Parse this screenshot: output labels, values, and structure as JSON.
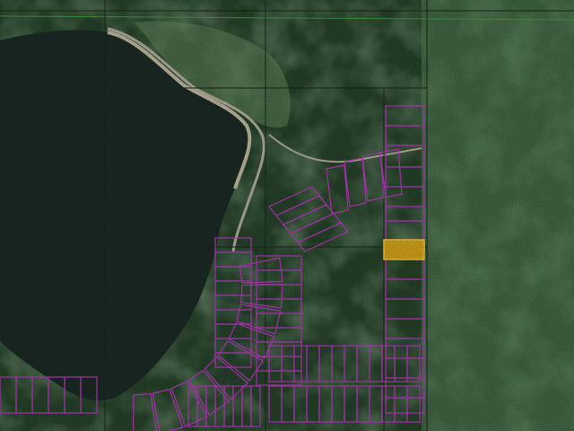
{
  "map": {
    "kind": "satellite-parcel-map",
    "colors": {
      "forest_dark": "#27452b",
      "forest_mid": "#3f6a43",
      "forest_light": "#5b8a59",
      "clearing": "#6b8f62",
      "lake": "#1c2c26",
      "shore": "#c8c1a8",
      "road": "#bdb7a3",
      "section_line": "#1f261f",
      "green_line": "#4aa04a",
      "parcel_outline": "#c23bc8",
      "selected_fill": "#f1b51a",
      "selected_outline": "#ffd23c"
    },
    "selected_parcel": {
      "state": "highlighted"
    }
  }
}
